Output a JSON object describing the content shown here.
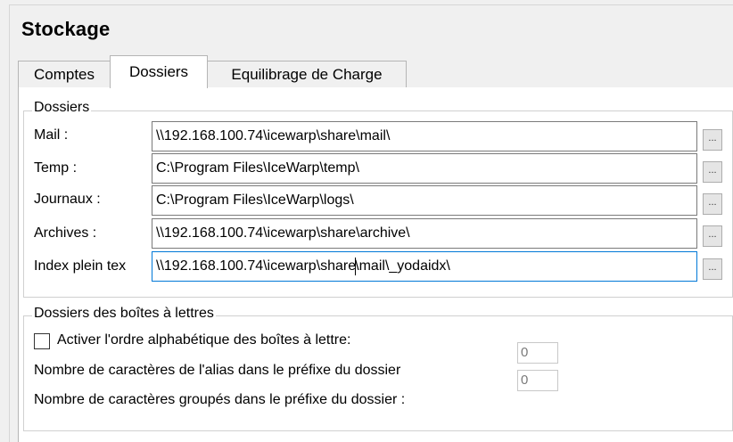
{
  "page": {
    "title": "Stockage"
  },
  "tabs": [
    {
      "label": "Comptes"
    },
    {
      "label": "Dossiers"
    },
    {
      "label": "Equilibrage de Charge"
    }
  ],
  "folders": {
    "group_title": "Dossiers",
    "rows": [
      {
        "label": "Mail :",
        "value": "\\\\192.168.100.74\\icewarp\\share\\mail\\",
        "browse": "..."
      },
      {
        "label": "Temp :",
        "value": "C:\\Program Files\\IceWarp\\temp\\",
        "browse": "..."
      },
      {
        "label": "Journaux :",
        "value": "C:\\Program Files\\IceWarp\\logs\\",
        "browse": "..."
      },
      {
        "label": "Archives :",
        "value": "\\\\192.168.100.74\\icewarp\\share\\archive\\",
        "browse": "..."
      },
      {
        "label": "Index plein tex",
        "value_before_caret": "\\\\192.168.100.74\\icewarp\\share",
        "value_after_caret": "\\mail\\_yodaidx\\",
        "browse": "..."
      }
    ]
  },
  "mailboxes": {
    "group_title": "Dossiers des boîtes à lettres",
    "alpha_order_label": "Activer l'ordre alphabétique des boîtes à lettre:",
    "alpha_order_checked": false,
    "alias_chars_label": "Nombre de caractères de l'alias dans le préfixe du dossier",
    "alias_chars_value": "0",
    "grouped_chars_label": "Nombre de caractères groupés dans le préfixe du dossier :",
    "grouped_chars_value": "0"
  }
}
